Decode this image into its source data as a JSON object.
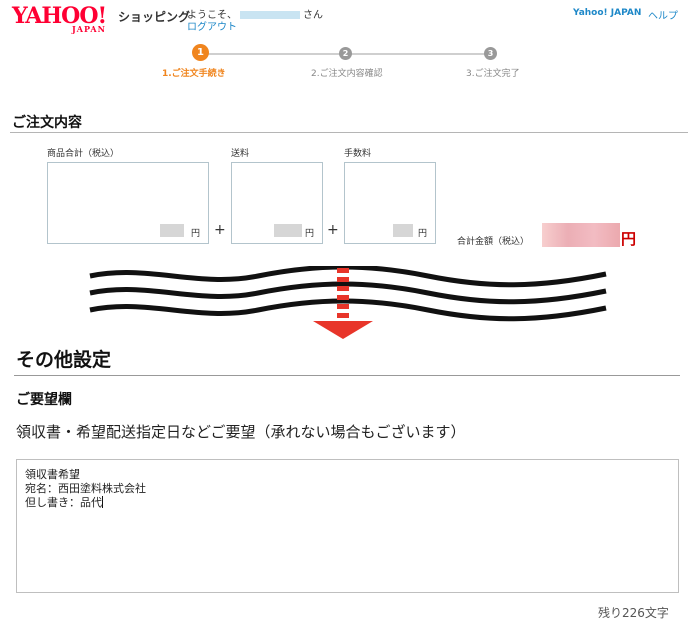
{
  "header": {
    "logo_text": "YAHOO!",
    "logo_sub": "JAPAN",
    "service_name": "ショッピング",
    "welcome_prefix": "ようこそ、",
    "welcome_suffix": "さん",
    "logout_label": "ログアウト",
    "yahoo_japan_link": "Yahoo! JAPAN",
    "help_link": "ヘルプ"
  },
  "steps": [
    {
      "number": "1",
      "label": "1.ご注文手続き",
      "active": true
    },
    {
      "number": "2",
      "label": "2.ご注文内容確認",
      "active": false
    },
    {
      "number": "3",
      "label": "3.ご注文完了",
      "active": false
    }
  ],
  "order": {
    "section_title": "ご注文内容",
    "subtotal_label": "商品合計（税込）",
    "shipping_label": "送料",
    "fee_label": "手数料",
    "yen": "円",
    "plus": "+",
    "total_label": "合計金額（税込）",
    "total_yen": "円"
  },
  "other": {
    "section_title": "その他設定",
    "request_title": "ご要望欄",
    "request_description": "領収書・希望配送指定日などご要望（承れない場合もございます）",
    "request_text": "領収書希望\n宛名：西田塗料株式会社\n但し書き：品代",
    "remaining": "残り226文字"
  },
  "colors": {
    "active_step": "#f0851e",
    "inactive_step": "#999999",
    "brand_red": "#ff0033",
    "link_blue": "#1e88c8",
    "arrow_red": "#e8352a"
  }
}
